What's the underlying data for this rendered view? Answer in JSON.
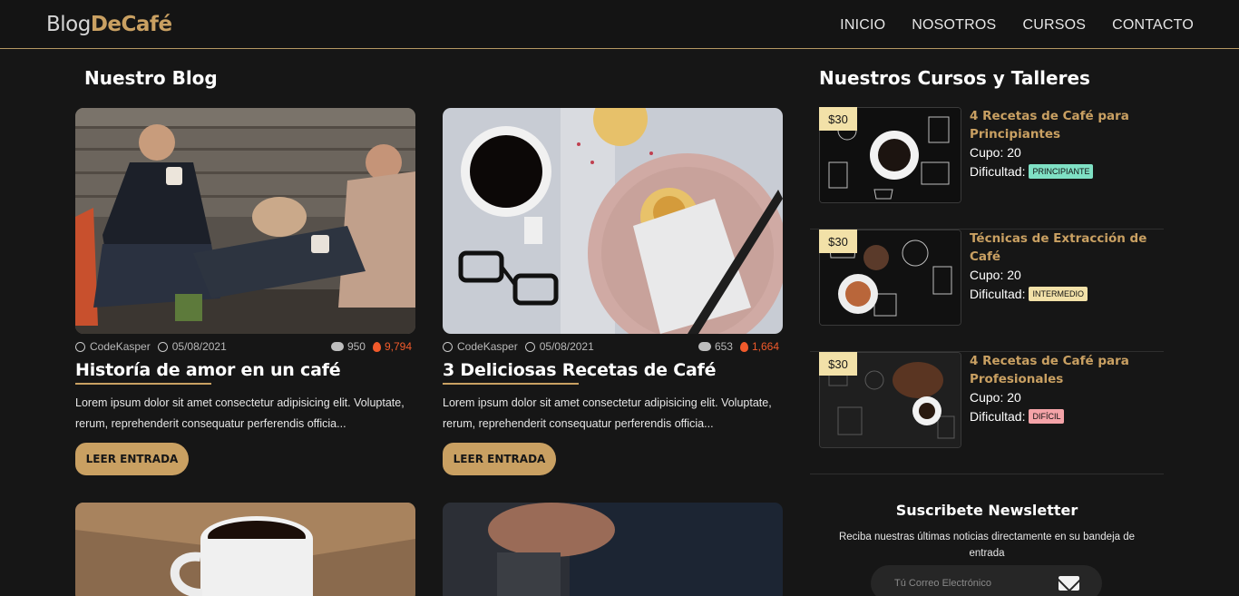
{
  "header": {
    "logo_part1": "Blog",
    "logo_part2": "DeCafé",
    "nav": [
      "INICIO",
      "NOSOTROS",
      "CURSOS",
      "CONTACTO"
    ]
  },
  "blog": {
    "title": "Nuestro Blog",
    "posts": [
      {
        "author": "CodeKasper",
        "date": "05/08/2021",
        "comments": "950",
        "likes": "9,794",
        "title": "Historía de amor en un café",
        "excerpt": "Lorem ipsum dolor sit amet consectetur adipisicing elit. Voluptate, rerum, reprehenderit consequatur perferendis officia...",
        "button": "LEER ENTRADA"
      },
      {
        "author": "CodeKasper",
        "date": "05/08/2021",
        "comments": "653",
        "likes": "1,664",
        "title": "3 Deliciosas Recetas de Café",
        "excerpt": "Lorem ipsum dolor sit amet consectetur adipisicing elit. Voluptate, rerum, reprehenderit consequatur perferendis officia...",
        "button": "LEER ENTRADA"
      }
    ]
  },
  "courses": {
    "title": "Nuestros Cursos y Talleres",
    "items": [
      {
        "price": "$30",
        "title": "4 Recetas de Café para Principiantes",
        "cupo": "Cupo: 20",
        "dificultad_label": "Dificultad:",
        "dificultad": "PRINCIPIANTE",
        "badge_color": "#7fe0c4"
      },
      {
        "price": "$30",
        "title": "Técnicas de Extracción de Café",
        "cupo": "Cupo: 20",
        "dificultad_label": "Dificultad:",
        "dificultad": "INTERMEDIO",
        "badge_color": "#f2e1a8"
      },
      {
        "price": "$30",
        "title": "4 Recetas de Café para Profesionales",
        "cupo": "Cupo: 20",
        "dificultad_label": "Dificultad:",
        "dificultad": "DIFÍCIL",
        "badge_color": "#f4a3a8"
      }
    ]
  },
  "newsletter": {
    "title": "Suscribete Newsletter",
    "text": "Reciba nuestras últimas noticias directamente en su bandeja de entrada",
    "placeholder": "Tú Correo Electrónico"
  },
  "colors": {
    "accent": "#c9a062",
    "background": "#161616",
    "likes": "#f15a2b"
  }
}
